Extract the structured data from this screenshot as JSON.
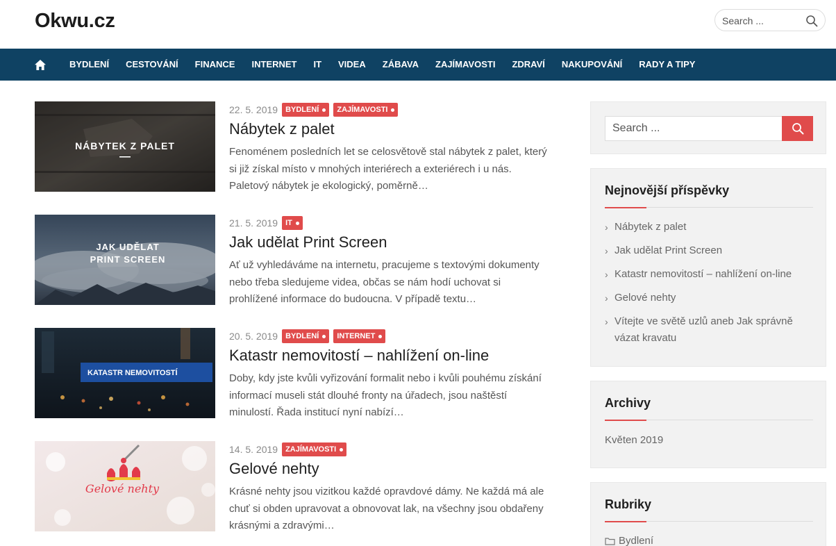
{
  "site": {
    "title": "Okwu.cz"
  },
  "header_search": {
    "placeholder": "Search ..."
  },
  "nav": {
    "items": [
      "Bydlení",
      "Cestování",
      "Finance",
      "Internet",
      "IT",
      "Videa",
      "Zábava",
      "Zajímavosti",
      "Zdraví",
      "Nakupování",
      "Rady a tipy"
    ]
  },
  "posts": [
    {
      "date": "22. 5. 2019",
      "categories": [
        "BYDLENÍ",
        "ZAJÍMAVOSTI"
      ],
      "title": "Nábytek z palet",
      "excerpt": "Fenoménem posledních let se celosvětově stal nábytek z palet, který si již získal místo v mnohých interiérech a exteriérech i u nás. Paletový nábytek je ekologický, poměrně…",
      "thumb_text": "NÁBYTEK Z PALET"
    },
    {
      "date": "21. 5. 2019",
      "categories": [
        "IT"
      ],
      "title": "Jak udělat Print Screen",
      "excerpt": "Ať už vyhledáváme na internetu, pracujeme s textovými dokumenty nebo třeba sledujeme videa, občas se nám hodí uchovat si prohlížené informace do budoucna. V případě textu…",
      "thumb_text_1": "JAK UDĚLAT",
      "thumb_text_2": "PRINT SCREEN"
    },
    {
      "date": "20. 5. 2019",
      "categories": [
        "BYDLENÍ",
        "INTERNET"
      ],
      "title": "Katastr nemovitostí – nahlížení on-line",
      "excerpt": "Doby, kdy jste kvůli vyřizování formalit nebo i kvůli pouhému získání informací museli stát dlouhé fronty na úřadech, jsou naštěstí minulostí. Řada institucí nyní nabízí…",
      "thumb_text": "KATASTR NEMOVITOSTÍ"
    },
    {
      "date": "14. 5. 2019",
      "categories": [
        "ZAJÍMAVOSTI"
      ],
      "title": "Gelové nehty",
      "excerpt": "Krásné nehty jsou vizitkou každé opravdové dámy. Ne každá má ale chuť si obden upravovat a obnovovat lak, na všechny jsou obdařeny krásnými a zdravými…",
      "thumb_text": "Gelové nehty"
    }
  ],
  "sidebar": {
    "search_placeholder": "Search ...",
    "recent": {
      "title": "Nejnovější příspěvky",
      "items": [
        "Nábytek z palet",
        "Jak udělat Print Screen",
        "Katastr nemovitostí – nahlížení on-line",
        "Gelové nehty",
        "Vítejte ve světě uzlů aneb Jak správně vázat kravatu"
      ]
    },
    "archive": {
      "title": "Archivy",
      "items": [
        "Květen 2019"
      ]
    },
    "categories": {
      "title": "Rubriky",
      "items": [
        "Bydlení"
      ]
    }
  },
  "colors": {
    "nav_bg": "#0f4263",
    "accent": "#e04b4b"
  }
}
